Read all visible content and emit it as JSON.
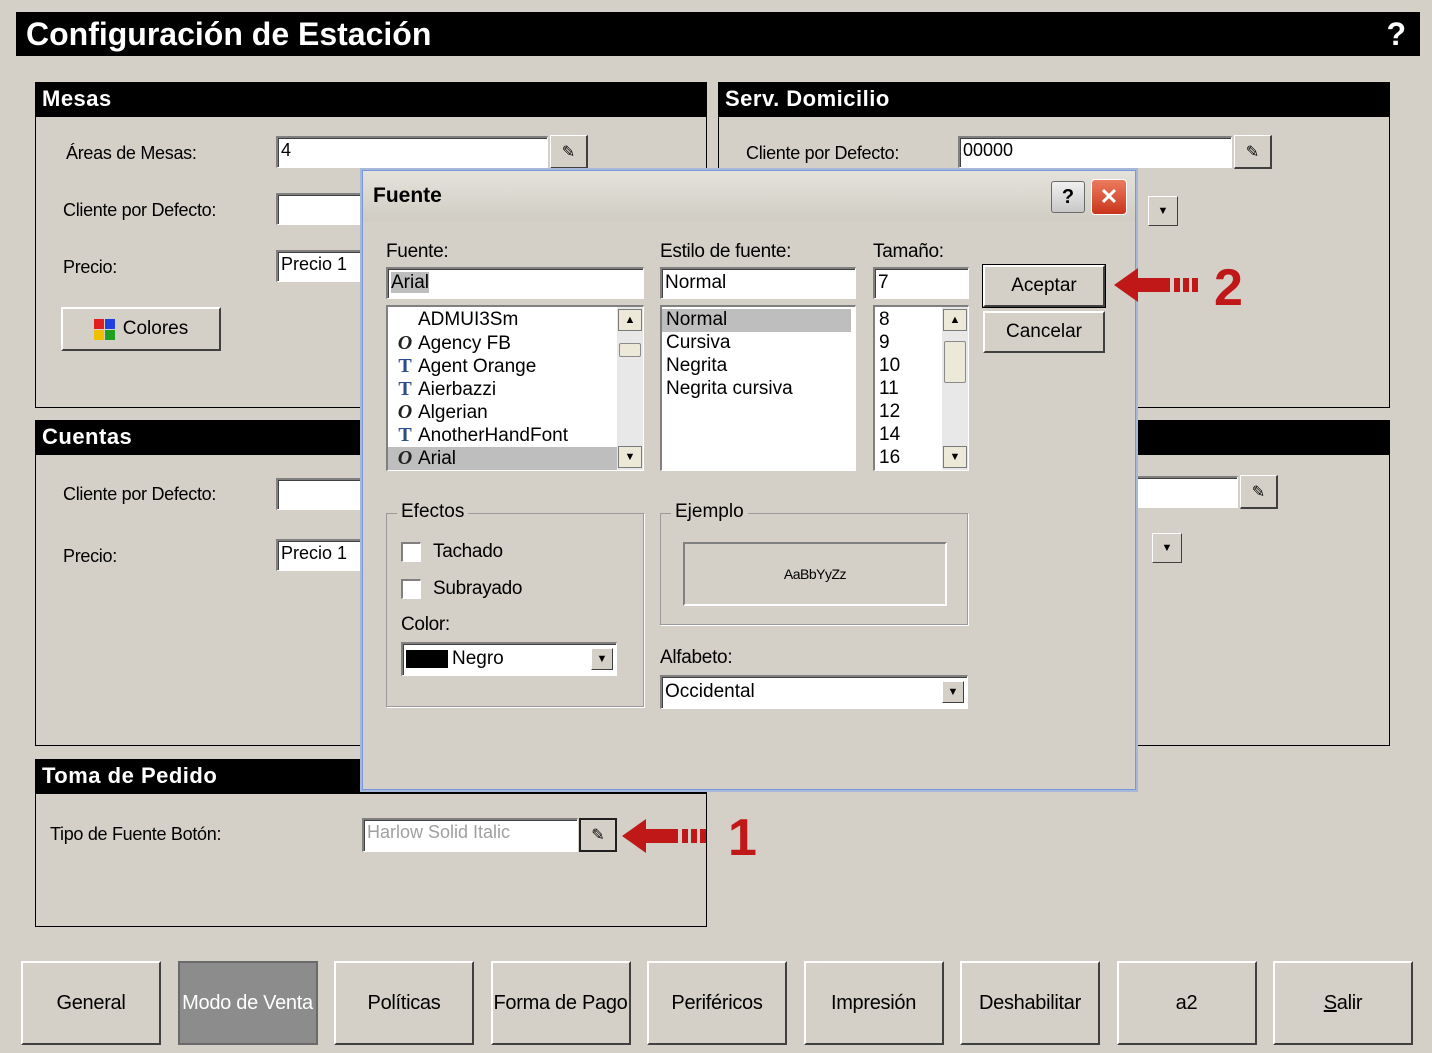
{
  "window": {
    "title": "Configuración de Estación",
    "help": "?"
  },
  "mesas": {
    "title": "Mesas",
    "areas_label": "Áreas de Mesas:",
    "areas_value": "4",
    "cliente_label": "Cliente por Defecto:",
    "cliente_value": "",
    "precio_label": "Precio:",
    "precio_value": "Precio 1",
    "colores_label": "Colores"
  },
  "domicilio": {
    "title": "Serv. Domicilio",
    "cliente_label": "Cliente por Defecto:",
    "cliente_value": "00000"
  },
  "cuentas": {
    "title": "Cuentas",
    "cliente_label": "Cliente por Defecto:",
    "cliente_value": "",
    "precio_label": "Precio:",
    "precio_value": "Precio 1"
  },
  "pedido": {
    "title": "Toma de Pedido",
    "fuente_label": "Tipo de Fuente Botón:",
    "fuente_value": "Harlow Solid Italic"
  },
  "dialog": {
    "title": "Fuente",
    "help": "?",
    "close": "✕",
    "font_label": "Fuente:",
    "font_value": "Arial",
    "fonts": [
      {
        "name": "ADMUI3Sm",
        "icon": "none"
      },
      {
        "name": "Agency FB",
        "icon": "opentype-icon"
      },
      {
        "name": "Agent Orange",
        "icon": "truetype-icon"
      },
      {
        "name": "Aierbazzi",
        "icon": "truetype-icon"
      },
      {
        "name": "Algerian",
        "icon": "opentype-icon"
      },
      {
        "name": "AnotherHandFont",
        "icon": "truetype-icon"
      },
      {
        "name": "Arial",
        "icon": "opentype-icon",
        "selected": true
      }
    ],
    "style_label": "Estilo de fuente:",
    "style_value": "Normal",
    "styles": [
      "Normal",
      "Cursiva",
      "Negrita",
      "Negrita cursiva"
    ],
    "size_label": "Tamaño:",
    "size_value": "7",
    "sizes": [
      "8",
      "9",
      "10",
      "11",
      "12",
      "14",
      "16"
    ],
    "accept": "Aceptar",
    "cancel": "Cancelar",
    "effects_label": "Efectos",
    "strike_label": "Tachado",
    "underline_label": "Subrayado",
    "color_label": "Color:",
    "color_value": "Negro",
    "sample_label": "Ejemplo",
    "sample_text": "AaBbYyZz",
    "script_label": "Alfabeto:",
    "script_value": "Occidental"
  },
  "annotations": {
    "one": "1",
    "two": "2",
    "arrow_color": "#c01818"
  },
  "tabs": [
    "General",
    "Modo de Venta",
    "Políticas",
    "Forma de Pago",
    "Periféricos",
    "Impresión",
    "Deshabilitar",
    "a2",
    "Salir"
  ],
  "active_tab": "Modo de Venta"
}
